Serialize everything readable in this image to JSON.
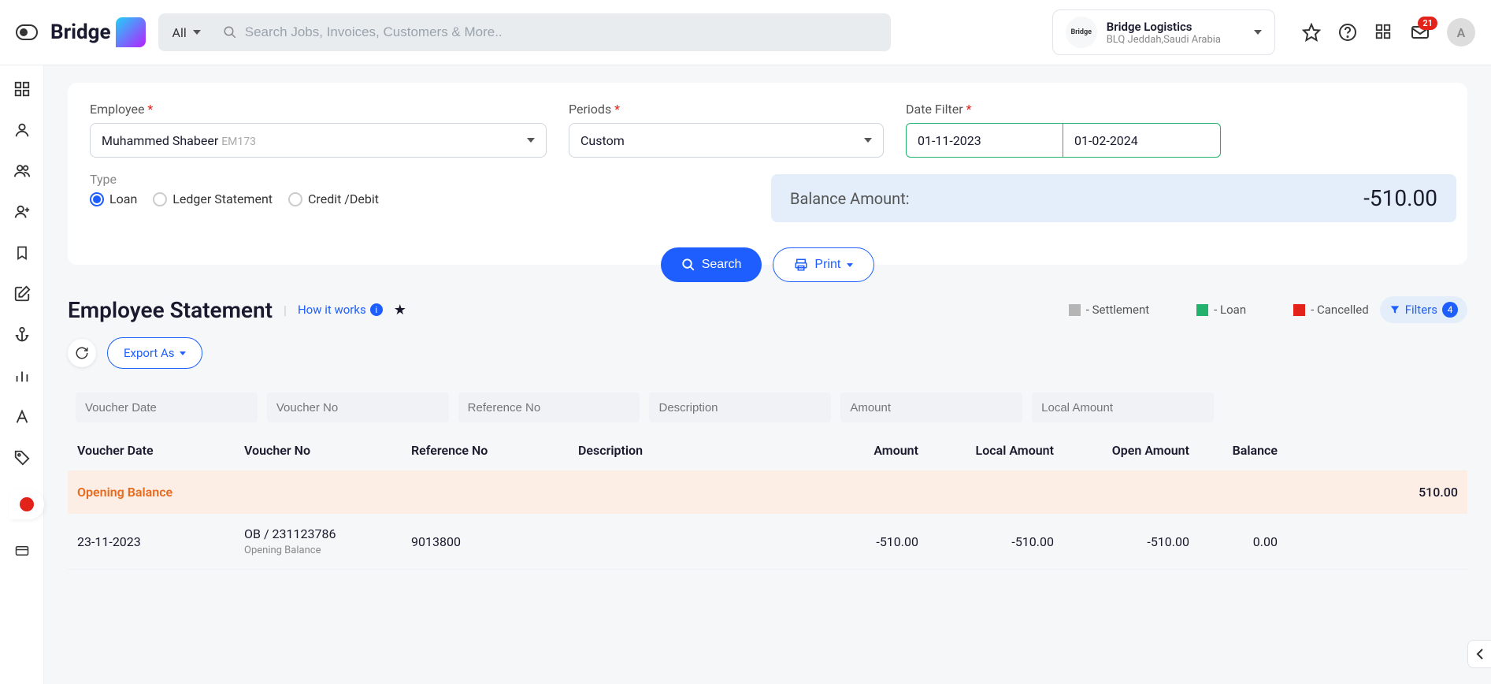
{
  "header": {
    "logo_text": "Bridge",
    "search_category": "All",
    "search_placeholder": "Search Jobs, Invoices, Customers & More..",
    "org_name": "Bridge Logistics",
    "org_sub": "BLQ Jeddah,Saudi Arabia",
    "notif_count": "21",
    "avatar_initial": "A",
    "org_logo_text": "Bridge"
  },
  "filters": {
    "employee_label": "Employee",
    "employee_value": "Muhammed Shabeer",
    "employee_code": "EM173",
    "periods_label": "Periods",
    "periods_value": "Custom",
    "date_filter_label": "Date Filter",
    "date_from": "01-11-2023",
    "date_to": "01-02-2024",
    "type_label": "Type",
    "type_options": {
      "loan": "Loan",
      "ledger": "Ledger Statement",
      "credit": "Credit /Debit"
    },
    "balance_label": "Balance Amount:",
    "balance_value": "-510.00",
    "search_btn": "Search",
    "print_btn": "Print"
  },
  "page": {
    "title": "Employee Statement",
    "how_it_works": "How it works",
    "legend": {
      "settlement": "- Settlement",
      "loan": "- Loan",
      "cancelled": "- Cancelled"
    },
    "filters_chip": "Filters",
    "filters_count": "4",
    "export_btn": "Export As"
  },
  "table": {
    "filter_placeholders": {
      "voucher_date": "Voucher Date",
      "voucher_no": "Voucher No",
      "reference_no": "Reference No",
      "description": "Description",
      "amount": "Amount",
      "local_amount": "Local Amount"
    },
    "columns": {
      "voucher_date": "Voucher Date",
      "voucher_no": "Voucher No",
      "reference_no": "Reference No",
      "description": "Description",
      "amount": "Amount",
      "local_amount": "Local Amount",
      "open_amount": "Open Amount",
      "balance": "Balance"
    },
    "opening_balance_label": "Opening Balance",
    "opening_balance_value": "510.00",
    "rows": [
      {
        "voucher_date": "23-11-2023",
        "voucher_no": "OB / 231123786",
        "voucher_no_sub": "Opening Balance",
        "reference_no": "9013800",
        "description": "",
        "amount": "-510.00",
        "local_amount": "-510.00",
        "open_amount": "-510.00",
        "balance": "0.00"
      }
    ]
  }
}
